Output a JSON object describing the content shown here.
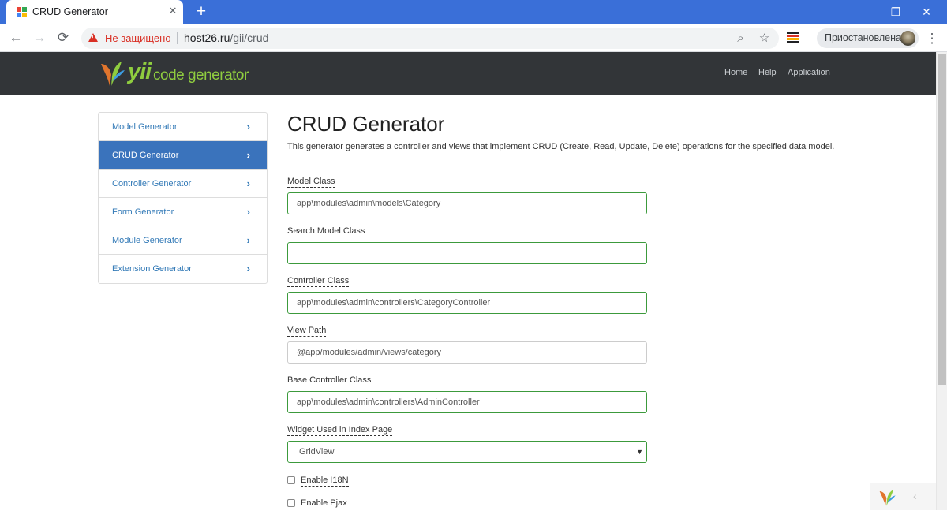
{
  "browser": {
    "tab_title": "CRUD Generator",
    "tab_close": "✕",
    "new_tab": "+",
    "window_controls": {
      "minimize": "—",
      "restore": "❐",
      "close": "✕"
    },
    "nav": {
      "back": "←",
      "forward": "→",
      "reload": "⟳"
    },
    "security_text": "Не защищено",
    "url_host": "host26.ru",
    "url_path": "/gii/crud",
    "zoom_icon": "⌕",
    "bookmark_icon": "☆",
    "profile_label": "Приостановлена",
    "menu_icon": "⋮",
    "favicon_colors": [
      "#ea4335",
      "#34a853",
      "#4285f4",
      "#fbbc05"
    ],
    "extension_colors": [
      "#202124",
      "#d93025",
      "#f9ab00",
      "#202124"
    ]
  },
  "navbar": {
    "brand_yii": "yii",
    "brand_rest": "code generator",
    "links": [
      "Home",
      "Help",
      "Application"
    ]
  },
  "sidebar": {
    "items": [
      {
        "label": "Model Generator",
        "active": false
      },
      {
        "label": "CRUD Generator",
        "active": true
      },
      {
        "label": "Controller Generator",
        "active": false
      },
      {
        "label": "Form Generator",
        "active": false
      },
      {
        "label": "Module Generator",
        "active": false
      },
      {
        "label": "Extension Generator",
        "active": false
      }
    ],
    "chevron": "›"
  },
  "main": {
    "title": "CRUD Generator",
    "description": "This generator generates a controller and views that implement CRUD (Create, Read, Update, Delete) operations for the specified data model.",
    "fields": {
      "model_class": {
        "label": "Model Class",
        "value": "app\\modules\\admin\\models\\Category"
      },
      "search_model_class": {
        "label": "Search Model Class",
        "value": ""
      },
      "controller_class": {
        "label": "Controller Class",
        "value": "app\\modules\\admin\\controllers\\CategoryController"
      },
      "view_path": {
        "label": "View Path",
        "value": "@app/modules/admin/views/category"
      },
      "base_controller_class": {
        "label": "Base Controller Class",
        "value": "app\\modules\\admin\\controllers\\AdminController"
      },
      "widget": {
        "label": "Widget Used in Index Page",
        "value": "GridView",
        "arrow": "▼"
      }
    },
    "checkboxes": {
      "i18n": {
        "label": "Enable I18N",
        "checked": false
      },
      "pjax": {
        "label": "Enable Pjax",
        "checked": false
      }
    }
  },
  "debug_toolbar": {
    "toggle": "‹"
  },
  "colors": {
    "tabbar": "#3a6fd8",
    "navbar": "#323538",
    "brand": "#8fcd3f",
    "active_item": "#3a73bc",
    "link": "#337ab7",
    "input_success_border": "#3c9a3c"
  }
}
